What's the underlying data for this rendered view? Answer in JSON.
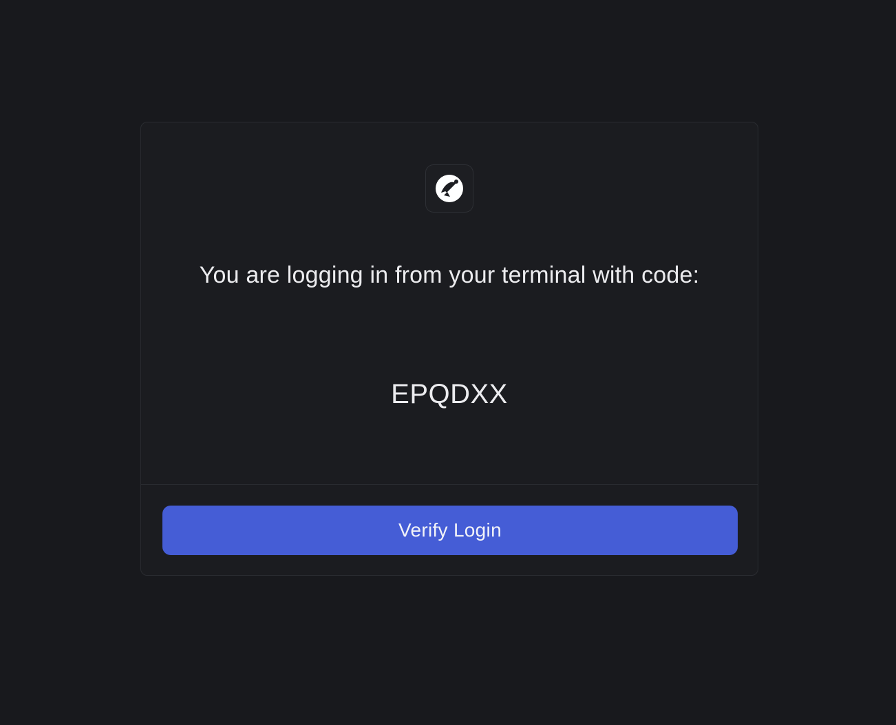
{
  "login": {
    "logo_icon": "satellite-dish-icon",
    "message": "You are logging in from your terminal with code:",
    "code": "EPQDXX",
    "verify_button_label": "Verify Login"
  },
  "colors": {
    "background": "#18191d",
    "card": "#1b1c20",
    "accent": "#455dd6"
  }
}
